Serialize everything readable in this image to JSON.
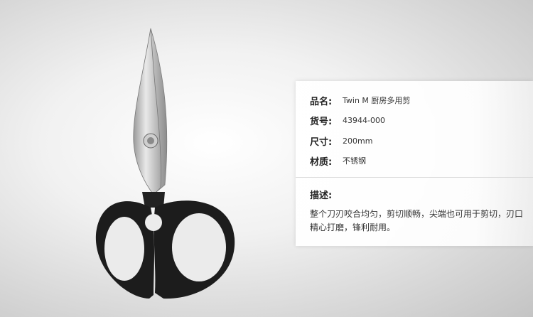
{
  "product": {
    "image_alt": "Twin M kitchen scissors",
    "specs": [
      {
        "label": "品名:",
        "value": "Twin M 厨房多用剪"
      },
      {
        "label": "货号:",
        "value": "43944-000"
      },
      {
        "label": "尺寸:",
        "value": "200mm"
      },
      {
        "label": "材质:",
        "value": "不锈钢"
      }
    ],
    "description_label": "描述:",
    "description": "整个刀刃咬合均匀，剪切顺畅，尖端也可用于剪切，刃口精心打磨，锋利耐用。"
  },
  "colors": {
    "handle": "#1c1c1c",
    "blade": "#c8c8c8"
  }
}
